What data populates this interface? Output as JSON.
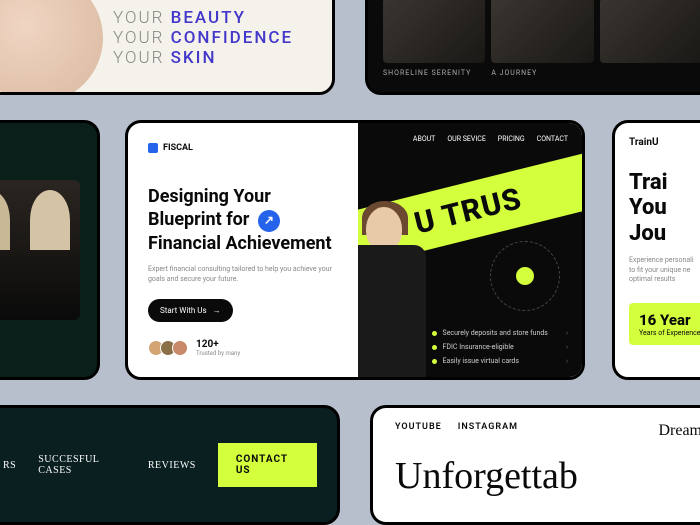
{
  "card1": {
    "line1_prefix": "YOUR ",
    "line1_accent": "BEAUTY",
    "line2_prefix": "YOUR ",
    "line2_accent": "CONFIDENCE",
    "line3_prefix": "YOUR ",
    "line3_accent": "SKIN"
  },
  "card2": {
    "label1": "SHORELINE SERENITY",
    "label2": "A JOURNEY"
  },
  "card4": {
    "logo": "FISCAL",
    "nav": [
      "ABOUT",
      "OUR SEVICE",
      "PRICING",
      "CONTACT"
    ],
    "headline_l1": "Designing Your",
    "headline_l2": "Blueprint for",
    "headline_l3": "Financial Achievement",
    "arrow_glyph": "↗",
    "subtext": "Expert financial consulting tailored to help you achieve your goals and secure your future.",
    "cta": "Start With Us",
    "cta_arrow": "→",
    "count": "120+",
    "count_sub": "Trusted by many",
    "banner": "U TRUS",
    "features": [
      "Securely deposits and store funds",
      "FDIC Insurance-eligible",
      "Easily issue virtual cards"
    ]
  },
  "card5": {
    "logo": "TrainU",
    "headline": "Trai\nYou\nJou",
    "subtext": "Experience personali\nto fit your unique ne\noptimal results",
    "badge_num": "16 Year",
    "badge_txt": "Years of Experience"
  },
  "card6": {
    "nav": [
      "RS",
      "SUCCESFUL CASES",
      "REVIEWS"
    ],
    "cta": "CONTACT US"
  },
  "card7": {
    "social": [
      "YOUTUBE",
      "INSTAGRAM"
    ],
    "script": "Dream",
    "big": "Unforgettab"
  }
}
